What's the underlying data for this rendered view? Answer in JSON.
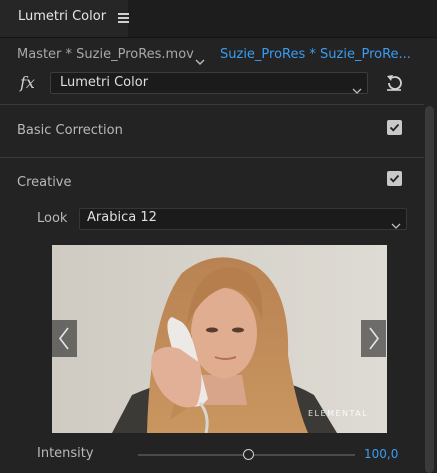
{
  "panel": {
    "title": "Lumetri Color",
    "menu_icon": "hamburger-menu-icon"
  },
  "clip_bar": {
    "master_label": "Master * Suzie_ProRes.mov",
    "active_label": "Suzie_ProRes * Suzie_ProRe..."
  },
  "effect": {
    "fx_label": "fx",
    "selected": "Lumetri Color",
    "reset_icon": "reset-icon"
  },
  "sections": {
    "basic_correction": {
      "label": "Basic Correction",
      "checked": true
    },
    "creative": {
      "label": "Creative",
      "checked": true
    }
  },
  "look": {
    "label": "Look",
    "selected": "Arabica 12"
  },
  "preview": {
    "watermark": "ELEMENTAL",
    "prev_icon": "chevron-left-icon",
    "next_icon": "chevron-right-icon"
  },
  "intensity": {
    "label": "Intensity",
    "value": "100,0",
    "slider_fraction": 0.5
  },
  "colors": {
    "accent": "#3b9cf2",
    "panel_bg": "#232323",
    "header_bg": "#1d1d1d"
  }
}
